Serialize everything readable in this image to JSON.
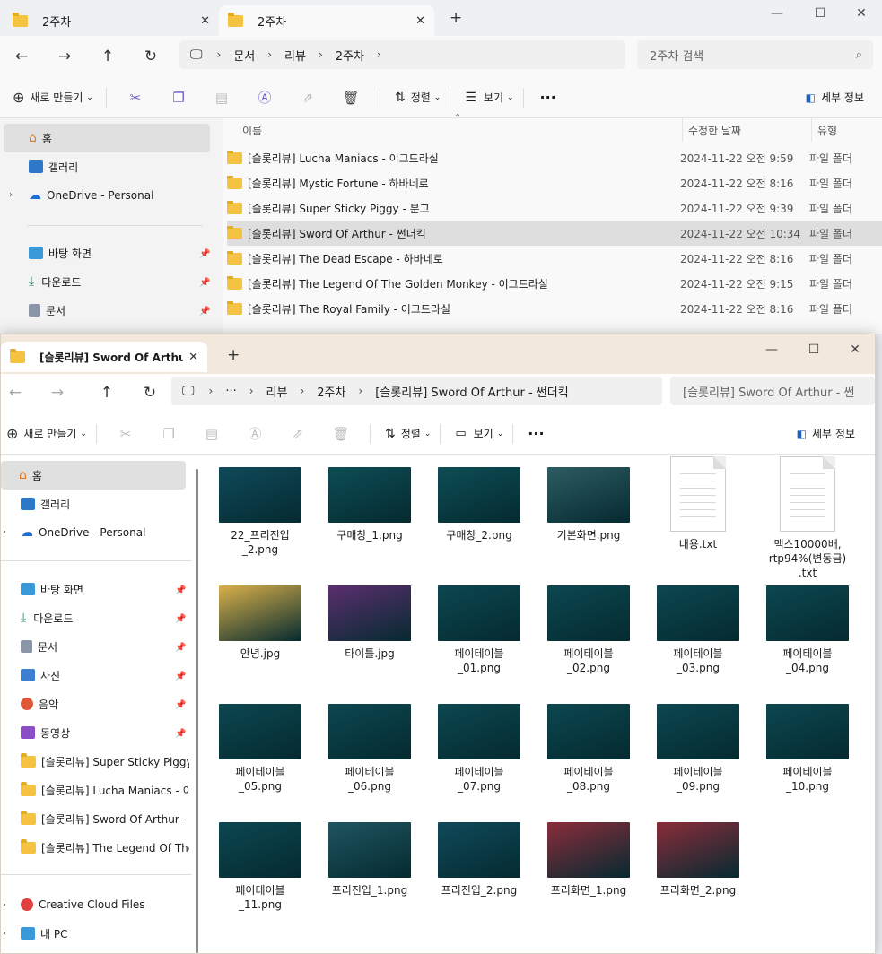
{
  "win1": {
    "tabs": [
      "2주차",
      "2주차"
    ],
    "breadcrumbs": [
      "문서",
      "리뷰",
      "2주차"
    ],
    "search_placeholder": "2주차 검색",
    "toolbar": {
      "new": "새로 만들기",
      "sort": "정렬",
      "view": "보기",
      "details": "세부 정보"
    },
    "sidebar": [
      {
        "label": "홈",
        "icon": "home-icon"
      },
      {
        "label": "갤러리",
        "icon": "gallery-icon"
      },
      {
        "label": "OneDrive - Personal",
        "icon": "cloud-icon"
      },
      {
        "label": "바탕 화면",
        "icon": "desktop-icon"
      },
      {
        "label": "다운로드",
        "icon": "download-icon"
      },
      {
        "label": "문서",
        "icon": "document-icon"
      }
    ],
    "columns": {
      "name": "이름",
      "date": "수정한 날짜",
      "type": "유형"
    },
    "rows": [
      {
        "name": "[슬롯리뷰] Lucha Maniacs - 이그드라실",
        "date": "2024-11-22 오전 9:59",
        "type": "파일 폴더"
      },
      {
        "name": "[슬롯리뷰] Mystic Fortune - 하바네로",
        "date": "2024-11-22 오전 8:16",
        "type": "파일 폴더"
      },
      {
        "name": "[슬롯리뷰] Super Sticky Piggy - 분고",
        "date": "2024-11-22 오전 9:39",
        "type": "파일 폴더"
      },
      {
        "name": "[슬롯리뷰] Sword Of Arthur - 썬더킥",
        "date": "2024-11-22 오전 10:34",
        "type": "파일 폴더"
      },
      {
        "name": "[슬롯리뷰] The Dead Escape - 하바네로",
        "date": "2024-11-22 오전 8:16",
        "type": "파일 폴더"
      },
      {
        "name": "[슬롯리뷰] The Legend Of The Golden Monkey - 이그드라실",
        "date": "2024-11-22 오전 9:15",
        "type": "파일 폴더"
      },
      {
        "name": "[슬롯리뷰] The Royal Family - 이그드라실",
        "date": "2024-11-22 오전 8:16",
        "type": "파일 폴더"
      }
    ]
  },
  "win2": {
    "tab": "[슬롯리뷰] Sword Of Arthur -",
    "breadcrumbs": [
      "···",
      "리뷰",
      "2주차",
      "[슬롯리뷰] Sword Of Arthur - 썬더킥"
    ],
    "search_placeholder": "[슬롯리뷰] Sword Of Arthur - 썬",
    "toolbar": {
      "new": "새로 만들기",
      "sort": "정렬",
      "view": "보기",
      "details": "세부 정보"
    },
    "sidebar": [
      {
        "label": "홈",
        "icon": "home-icon"
      },
      {
        "label": "갤러리",
        "icon": "gallery-icon"
      },
      {
        "label": "OneDrive - Personal",
        "icon": "cloud-icon"
      },
      {
        "label": "바탕 화면",
        "icon": "desktop-icon"
      },
      {
        "label": "다운로드",
        "icon": "download-icon"
      },
      {
        "label": "문서",
        "icon": "document-icon"
      },
      {
        "label": "사진",
        "icon": "pictures-icon"
      },
      {
        "label": "음악",
        "icon": "music-icon"
      },
      {
        "label": "동영상",
        "icon": "video-icon"
      },
      {
        "label": "[슬롯리뷰] Super Sticky Piggy",
        "icon": "folder-icon"
      },
      {
        "label": "[슬롯리뷰] Lucha Maniacs - 이",
        "icon": "folder-icon"
      },
      {
        "label": "[슬롯리뷰] Sword Of Arthur - 썬",
        "icon": "folder-icon"
      },
      {
        "label": "[슬롯리뷰] The Legend Of The",
        "icon": "folder-icon"
      },
      {
        "label": "Creative Cloud Files",
        "icon": "creative-cloud-icon"
      },
      {
        "label": "내 PC",
        "icon": "pc-icon"
      }
    ],
    "files": [
      {
        "name": "22_프리진입\n_2.png",
        "kind": "img",
        "color": "#0f4a5a"
      },
      {
        "name": "구매창_1.png",
        "kind": "img",
        "color": "#0d4d55"
      },
      {
        "name": "구매창_2.png",
        "kind": "img",
        "color": "#0d4d55"
      },
      {
        "name": "기본화면.png",
        "kind": "img",
        "color": "#2d5c63"
      },
      {
        "name": "내용.txt",
        "kind": "txt",
        "color": "#ffffff"
      },
      {
        "name": "맥스10000배,\nrtp94%(변동금)\n.txt",
        "kind": "txt",
        "color": "#ffffff"
      },
      {
        "name": "안녕.jpg",
        "kind": "img",
        "color": "#d9b04a"
      },
      {
        "name": "타이틀.jpg",
        "kind": "img",
        "color": "#5b2e6e"
      },
      {
        "name": "페이테이블\n_01.png",
        "kind": "img",
        "color": "#0c4750"
      },
      {
        "name": "페이테이블\n_02.png",
        "kind": "img",
        "color": "#0c4750"
      },
      {
        "name": "페이테이블\n_03.png",
        "kind": "img",
        "color": "#0c4750"
      },
      {
        "name": "페이테이블\n_04.png",
        "kind": "img",
        "color": "#0c4750"
      },
      {
        "name": "페이테이블\n_05.png",
        "kind": "img",
        "color": "#0c4750"
      },
      {
        "name": "페이테이블\n_06.png",
        "kind": "img",
        "color": "#0c4750"
      },
      {
        "name": "페이테이블\n_07.png",
        "kind": "img",
        "color": "#0c4750"
      },
      {
        "name": "페이테이블\n_08.png",
        "kind": "img",
        "color": "#0c4750"
      },
      {
        "name": "페이테이블\n_09.png",
        "kind": "img",
        "color": "#0c4750"
      },
      {
        "name": "페이테이블\n_10.png",
        "kind": "img",
        "color": "#0c4750"
      },
      {
        "name": "페이테이블\n_11.png",
        "kind": "img",
        "color": "#0c4750"
      },
      {
        "name": "프리진입_1.png",
        "kind": "img",
        "color": "#1f5560"
      },
      {
        "name": "프리진입_2.png",
        "kind": "img",
        "color": "#0f4a5a"
      },
      {
        "name": "프리화면_1.png",
        "kind": "img",
        "color": "#8a2c3a"
      },
      {
        "name": "프리화면_2.png",
        "kind": "img",
        "color": "#8a2c3a"
      }
    ]
  },
  "colors": {
    "accent": "#6a5acd",
    "folder": "#f5c342",
    "selection": "#dedede"
  }
}
